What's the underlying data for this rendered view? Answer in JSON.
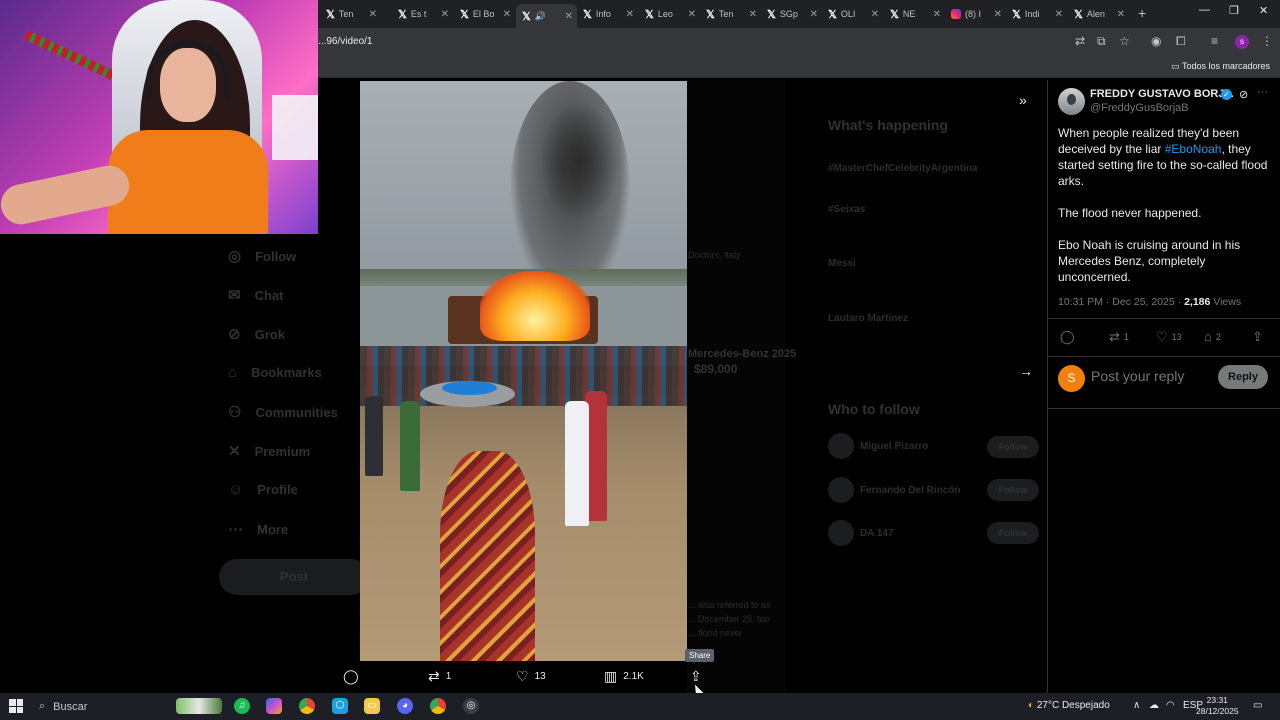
{
  "browser": {
    "tabs": [
      {
        "label": "Ten"
      },
      {
        "label": "Es t"
      },
      {
        "label": "El Bo"
      },
      {
        "label": ""
      },
      {
        "label": "Info"
      },
      {
        "label": "Leo"
      },
      {
        "label": "Ten"
      },
      {
        "label": "SGp"
      },
      {
        "label": "OLI"
      },
      {
        "label": "NE"
      },
      {
        "label": "(8) I"
      },
      {
        "label": "Indi"
      },
      {
        "label": "Alen"
      }
    ],
    "url": "...96/video/1",
    "bookmarks_all": "Todos los marcadores",
    "profile_letter": "s"
  },
  "background_app": {
    "nav": [
      "Follow",
      "Chat",
      "Grok",
      "Bookmarks",
      "Communities",
      "Premium",
      "Profile",
      "More"
    ],
    "post_button": "Post",
    "trending_title": "What's happening",
    "trends": [
      "#MasterChefCelebrityArgentina",
      "#Seixas",
      "Messi",
      "Lautaro Martínez"
    ],
    "who_to_follow_title": "Who to follow",
    "who_to_follow": [
      {
        "name": "Miguel Pizarro",
        "button": "Follow"
      },
      {
        "name": "Fernando Del Rincón",
        "button": "Follow"
      },
      {
        "name": "DA 147",
        "button": "Follow"
      }
    ],
    "middle_snippets": [
      "Doctors, Italy",
      "Mercedes-Benz 2025",
      "$89,000",
      "... also referred to as",
      "... December 25, too",
      "... flood never"
    ]
  },
  "video_controls": {
    "reply_count": "",
    "repost_count": "1",
    "like_count": "13",
    "views_count": "2.1K",
    "share_tooltip": "Share"
  },
  "tweet": {
    "author_name": "FREDDY GUSTAVO BORJ...",
    "handle": "@FreddyGusBorjaB",
    "text_part1": "When people realized they'd been deceived by the liar ",
    "hashtag": "#EboNoah",
    "text_part2": ", they started setting fire to the so-called flood arks.",
    "paragraph2": "The flood never happened.",
    "paragraph3": "Ebo Noah is cruising around in his Mercedes Benz, completely unconcerned.",
    "time": "10:31 PM · Dec 25, 2025 · ",
    "views_number": "2,186",
    "views_label": " Views",
    "replies": "",
    "reposts": "1",
    "likes": "13",
    "bookmarks": "2",
    "reply_avatar_letter": "S",
    "reply_placeholder": "Post your reply",
    "reply_button": "Reply"
  },
  "taskbar": {
    "search_label": "Buscar",
    "weather": "27°C  Despejado",
    "language": "ESP",
    "time": "23:31",
    "date": "28/12/2025"
  },
  "colors": {
    "accent_blue": "#1d9bf0",
    "reply_avatar": "#f4800c",
    "video_fire": "#ffb020"
  }
}
